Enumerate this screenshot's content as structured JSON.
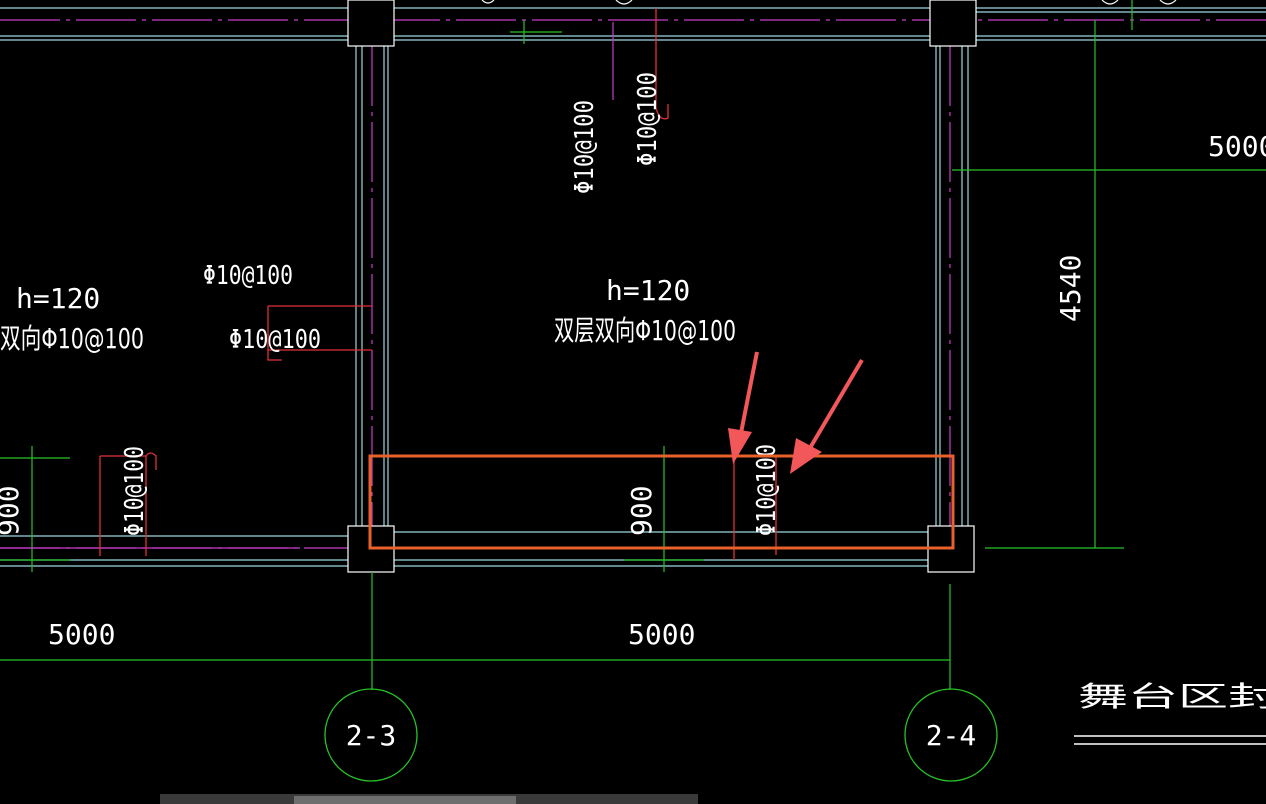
{
  "colors": {
    "background": "#000000",
    "wall_lines": "#9ad8e0",
    "dim_lines": "#27c227",
    "center_lines": "#c83cc8",
    "rebar": "#e0303a",
    "highlight": "#e8602a",
    "arrows": "#f2575a",
    "text": "#ffffff"
  },
  "slabs": [
    {
      "h": "h=120",
      "rebar": "双向Φ10@100"
    },
    {
      "h": "h=120",
      "rebar": "双层双向Φ10@100"
    }
  ],
  "rebar_labels": {
    "left_top": "Φ10@100",
    "left_mid": "Φ10@100",
    "top_a": "Φ10@100",
    "top_b": "Φ10@100",
    "bottom_left": "Φ10@100",
    "bottom_mid": "Φ10@100"
  },
  "dimensions": {
    "span_left": "5000",
    "span_mid": "5000",
    "span_right": "5000",
    "vertical": "4540",
    "strip_mid": "900",
    "strip_left": "900"
  },
  "grid_axes": [
    "2-3",
    "2-4"
  ],
  "title_partial": "舞台区封板"
}
